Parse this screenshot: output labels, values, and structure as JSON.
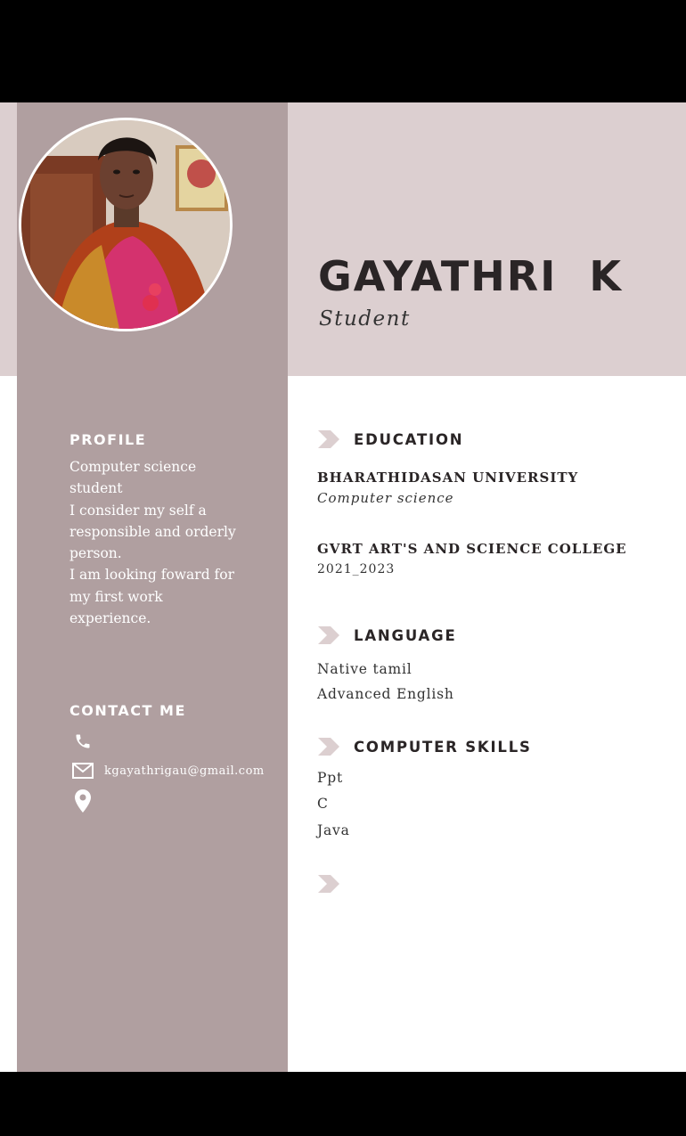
{
  "header": {
    "name": "GAYATHRI  K",
    "title": "Student"
  },
  "profile": {
    "heading": "PROFILE",
    "lines": [
      "Computer science",
      "student",
      "I consider my self a",
      "responsible and orderly",
      "person.",
      "I am looking foward for",
      "my first work",
      "experience."
    ]
  },
  "contact": {
    "heading": "CONTACT ME",
    "email": "kgayathrigau@gmail.com",
    "icons": [
      "phone-icon",
      "mail-icon",
      "location-pin-icon"
    ]
  },
  "education": {
    "heading": "EDUCATION",
    "entries": [
      {
        "institution": "BHARATHIDASAN UNIVERSITY",
        "detail": "Computer science"
      },
      {
        "institution": "GVRT ART'S AND SCIENCE COLLEGE",
        "detail": "2021_2023"
      }
    ]
  },
  "language": {
    "heading": "LANGUAGE",
    "items": [
      "Native tamil",
      "Advanced English"
    ]
  },
  "skills": {
    "heading": "COMPUTER SKILLS",
    "items": [
      "Ppt",
      "C",
      "Java"
    ]
  },
  "colors": {
    "sidebar": "#b09fa0",
    "top_band": "#dccfd0",
    "heading_text": "#2a2526",
    "chevron": "#dccfd0"
  }
}
